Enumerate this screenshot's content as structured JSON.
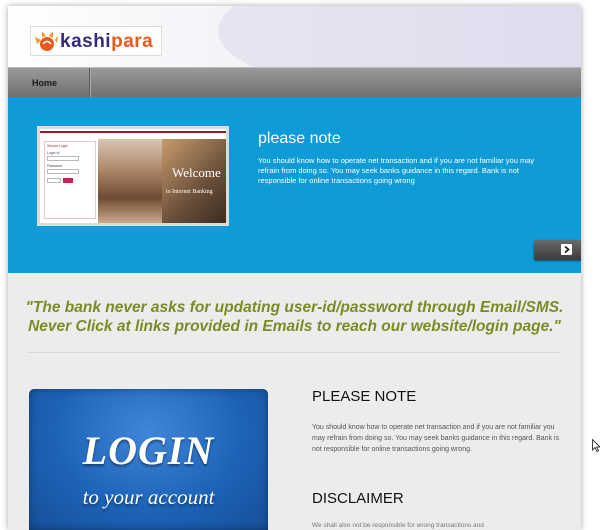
{
  "logo": {
    "brand_part1": "kashi",
    "brand_part2": "para",
    "tag_left": "",
    "tag_right": "",
    "icon": "sun-rays-logo-icon"
  },
  "nav": {
    "home_label": "Home"
  },
  "banner": {
    "title": "please note",
    "text": "You should know how to operate net transaction and if you are not familiar you may refrain from doing so. You may seek banks guidance in this regard. Bank is not responsible for online transactions going wrong",
    "slide": {
      "form_title": "Secure Login",
      "login_id_label": "Login Id",
      "password_label": "Password",
      "welcome_word": "Welcome",
      "welcome_sub": "to Internet Banking"
    },
    "next_icon": "chevron-right-icon"
  },
  "slogan": {
    "line1": "\"The bank never asks for updating user-id/password through Email/SMS.",
    "line2": "Never Click at links provided in Emails to reach our website/login page.\""
  },
  "login_box": {
    "word": "LOGIN",
    "sub": "to your account"
  },
  "notice": {
    "title": "PLEASE NOTE",
    "text": "You should know how to operate net transaction and if you are not familiar you may refrain from doing so. You may seek banks guidance in this regard. Bank is not responsible for online transactions going wrong."
  },
  "disclaimer": {
    "title": "DISCLAIMER",
    "text": "We shall also not be responsible for wrong transactions and"
  },
  "colors": {
    "banner_blue": "#0f9bd6",
    "slogan_green": "#7c8b26",
    "login_blue": "#1d63b8",
    "nav_gray": "#7f7f7f",
    "brand_orange": "#e85a1e",
    "brand_purple": "#3a2a7a"
  }
}
